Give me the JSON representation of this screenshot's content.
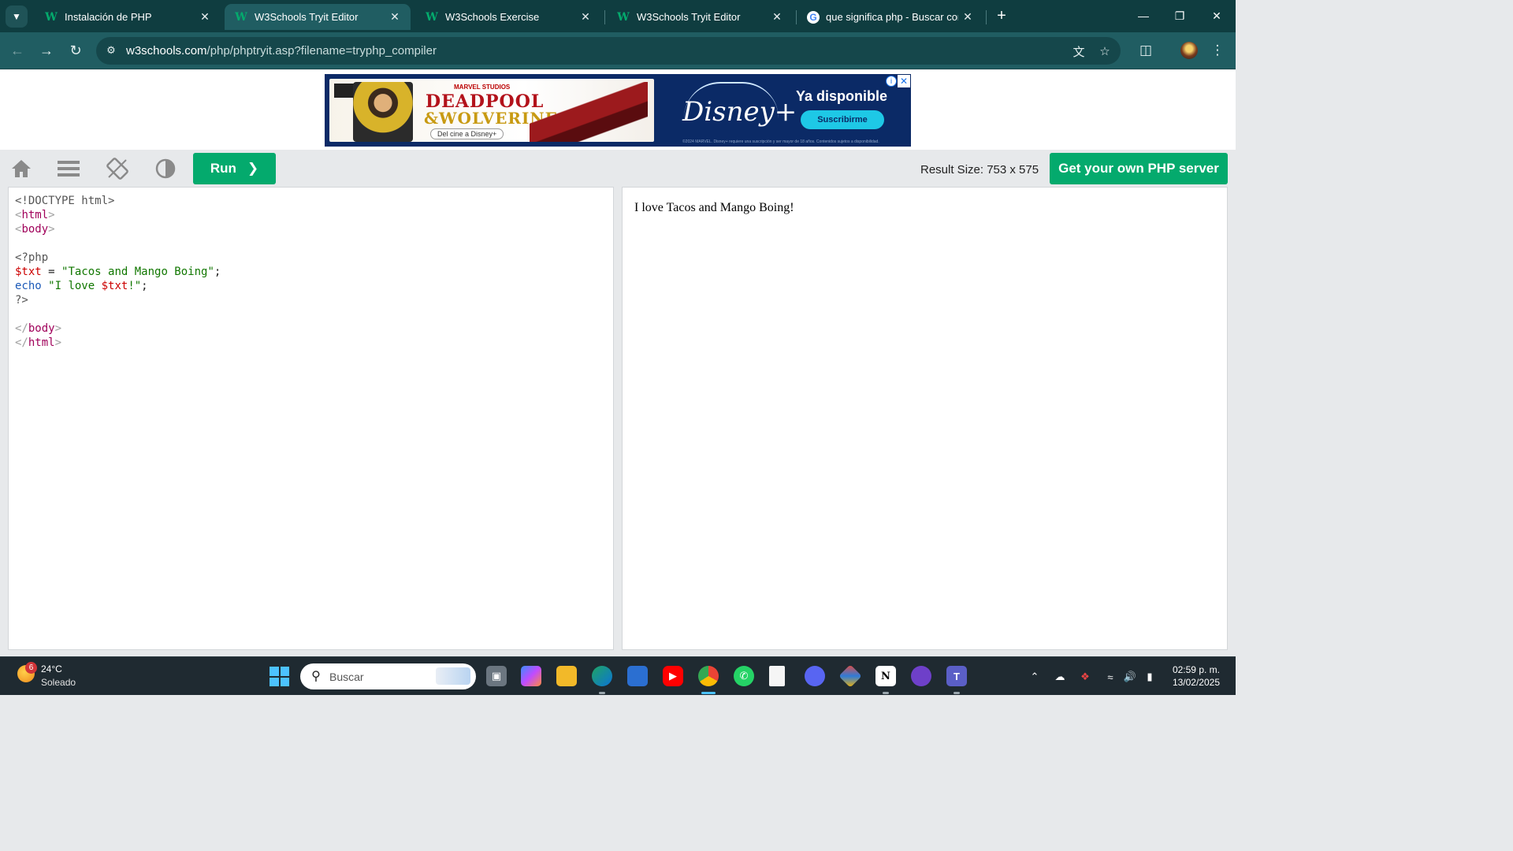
{
  "browser": {
    "tabs": [
      {
        "title": "Instalación de PHP",
        "favicon": "w3schools-icon",
        "active": false
      },
      {
        "title": "W3Schools Tryit Editor",
        "favicon": "w3schools-icon",
        "active": true
      },
      {
        "title": "W3Schools Exercise",
        "favicon": "w3schools-icon",
        "active": false
      },
      {
        "title": "W3Schools Tryit Editor",
        "favicon": "w3schools-icon",
        "active": false
      },
      {
        "title": "que significa php - Buscar con G",
        "favicon": "google-icon",
        "active": false
      }
    ],
    "new_tab_glyph": "+",
    "url_host": "w3schools.com",
    "url_path": "/php/phptryit.asp?filename=tryphp_compiler",
    "theme_color": "#205d62"
  },
  "ad": {
    "studio": "MARVEL STUDIOS",
    "title_line1": "DEADPOOL",
    "title_line2": "&WOLVERINE",
    "cinema_note": "Del cine a Disney+",
    "brand": "Disney+",
    "headline": "Ya disponible",
    "cta": "Suscribirme",
    "fine_print": "©2024 MARVEL. Disney+ requiere una suscripción y ser mayor de 18 años. Contenidos sujetos a disponibilidad."
  },
  "tryit": {
    "run_label": "Run",
    "result_size": "Result Size: 753 x 575",
    "get_server_label": "Get your own PHP server",
    "accent_color": "#04aa6d",
    "code": {
      "doctype": "<!DOCTYPE html>",
      "html_open": "html",
      "body_open": "body",
      "php_open": "<?php",
      "var_name": "$txt",
      "assign": " = ",
      "string_value": "\"Tacos and Mango Boing\"",
      "semicolon": ";",
      "echo_kw": "echo",
      "echo_str_start": "\"I love ",
      "echo_var": "$txt",
      "echo_str_end": "!\"",
      "php_close": "?>",
      "body_close": "body",
      "html_close": "html"
    },
    "output_text": "I love Tacos and Mango Boing!"
  },
  "taskbar": {
    "weather_badge": "6",
    "weather_temp": "24°C",
    "weather_desc": "Soleado",
    "search_placeholder": "Buscar",
    "time": "02:59 p. m.",
    "date": "13/02/2025"
  }
}
